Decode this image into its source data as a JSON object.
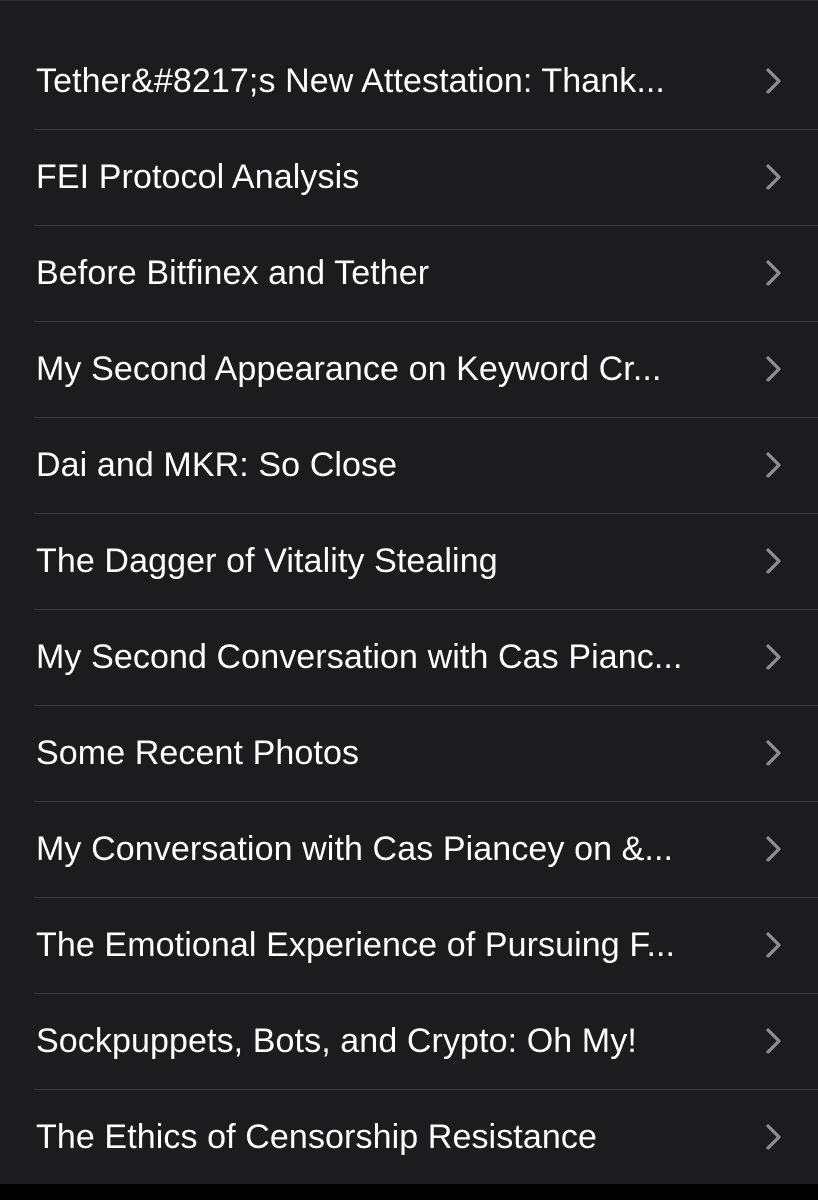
{
  "list": {
    "items": [
      {
        "label": "Tether&#8217;s New Attestation: Thank..."
      },
      {
        "label": "FEI Protocol Analysis"
      },
      {
        "label": "Before Bitfinex and Tether"
      },
      {
        "label": "My Second Appearance on Keyword Cr..."
      },
      {
        "label": "Dai and MKR: So Close"
      },
      {
        "label": "The Dagger of Vitality Stealing"
      },
      {
        "label": "My Second Conversation with Cas Pianc..."
      },
      {
        "label": "Some Recent Photos"
      },
      {
        "label": "My Conversation with Cas Piancey on &..."
      },
      {
        "label": "The Emotional Experience of Pursuing F..."
      },
      {
        "label": "Sockpuppets, Bots, and Crypto: Oh My!"
      },
      {
        "label": "The Ethics of Censorship Resistance"
      }
    ],
    "chevron_icon": "chevron-right-icon"
  },
  "colors": {
    "background": "#1c1c1e",
    "separator": "#38383a",
    "text": "#ffffff",
    "chevron": "#8e8e93"
  }
}
